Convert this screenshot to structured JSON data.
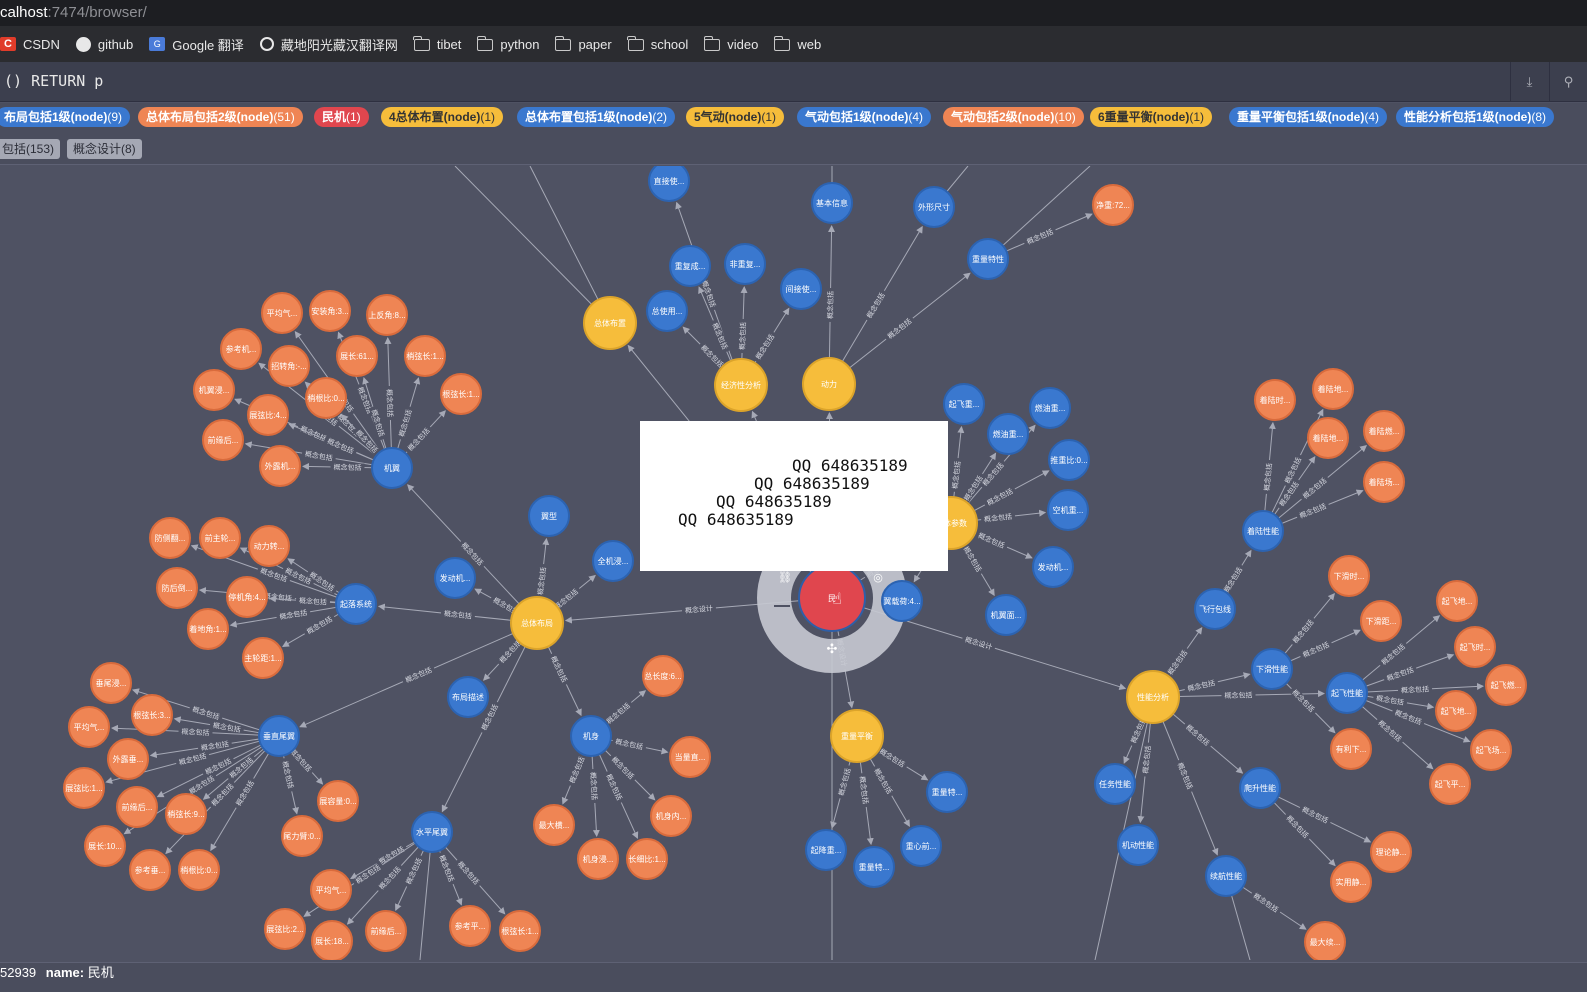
{
  "browser": {
    "url_host": "calhost",
    "url_rest": ":7474/browser/",
    "bookmarks": [
      {
        "label": "CSDN",
        "icon": "csdn-icon"
      },
      {
        "label": "github",
        "icon": "github-icon"
      },
      {
        "label": "Google 翻译",
        "icon": "google-translate-icon"
      },
      {
        "label": "藏地阳光藏汉翻译网",
        "icon": "globe-icon"
      },
      {
        "label": "tibet",
        "icon": "folder-icon"
      },
      {
        "label": "python",
        "icon": "folder-icon"
      },
      {
        "label": "paper",
        "icon": "folder-icon"
      },
      {
        "label": "school",
        "icon": "folder-icon"
      },
      {
        "label": "video",
        "icon": "folder-icon"
      },
      {
        "label": "web",
        "icon": "folder-icon"
      }
    ]
  },
  "editor": {
    "query": "() RETURN p",
    "download_icon": "download-icon",
    "pin_icon": "pin-icon"
  },
  "labels": [
    {
      "name": "布局包括1级(node)",
      "count": "(9)",
      "color": "blue"
    },
    {
      "name": "总体布局包括2级(node)",
      "count": "(51)",
      "color": "orange"
    },
    {
      "name": "民机",
      "count": "(1)",
      "color": "red"
    },
    {
      "name": "4总体布置(node)",
      "count": "(1)",
      "color": "yellow"
    },
    {
      "name": "总体布置包括1级(node)",
      "count": "(2)",
      "color": "blue"
    },
    {
      "name": "5气动(node)",
      "count": "(1)",
      "color": "yellow"
    },
    {
      "name": "气动包括1级(node)",
      "count": "(4)",
      "color": "blue"
    },
    {
      "name": "气动包括2级(node)",
      "count": "(10)",
      "color": "orange"
    },
    {
      "name": "6重量平衡(node)",
      "count": "(1)",
      "color": "yellow"
    },
    {
      "name": "重量平衡包括1级(node)",
      "count": "(4)",
      "color": "blue"
    },
    {
      "name": "性能分析包括1级(node)",
      "count": "(8)",
      "color": "blue"
    }
  ],
  "relationships": [
    {
      "name": "包括",
      "count": "(153)"
    },
    {
      "name": "概念设计",
      "count": "(8)"
    }
  ],
  "watermark": {
    "lines": [
      "QQ 648635189",
      "QQ 648635189",
      "QQ 648635189",
      "QQ 648635189"
    ]
  },
  "status": {
    "id_fragment": "52939",
    "key": "name:",
    "value": "民机"
  },
  "colors": {
    "blue": "#3a78cf",
    "orange": "#ef8554",
    "yellow": "#f6bd3b",
    "red": "#e0464e",
    "background": "#4f5263"
  },
  "graph": {
    "edge_labels": {
      "include": "概念包括",
      "design": "概念设计"
    },
    "hubs": [
      {
        "id": "zongtibuju",
        "label": "总体布局",
        "color": "yellow"
      },
      {
        "id": "zongtibuzhi",
        "label": "总体布置",
        "color": "yellow"
      },
      {
        "id": "jingji",
        "label": "经济性分析",
        "color": "yellow"
      },
      {
        "id": "dongli",
        "label": "动力",
        "color": "yellow"
      },
      {
        "id": "zongticanshu",
        "label": "总体参数",
        "color": "yellow"
      },
      {
        "id": "zhongliang",
        "label": "重量平衡",
        "color": "yellow"
      },
      {
        "id": "xingneng",
        "label": "性能分析",
        "color": "yellow"
      }
    ],
    "center": {
      "label": "民",
      "color": "red"
    },
    "nodes": [
      {
        "id": "jiyi",
        "label": "机翼",
        "color": "blue"
      },
      {
        "id": "qiluo",
        "label": "起落系统",
        "color": "blue"
      },
      {
        "id": "chuizhi",
        "label": "垂直尾翼",
        "color": "blue"
      },
      {
        "id": "shuiping",
        "label": "水平尾翼",
        "color": "blue"
      },
      {
        "id": "jishen",
        "label": "机身",
        "color": "blue"
      },
      {
        "id": "buju",
        "label": "布局描述",
        "color": "blue"
      },
      {
        "id": "fadong",
        "label": "发动机...",
        "color": "blue"
      },
      {
        "id": "yixing",
        "label": "翼型",
        "color": "blue"
      },
      {
        "id": "quanji",
        "label": "全机浸...",
        "color": "blue"
      },
      {
        "id": "zhijie",
        "label": "直接使...",
        "color": "blue"
      },
      {
        "id": "chongfu",
        "label": "重复成...",
        "color": "blue"
      },
      {
        "id": "feichong",
        "label": "非重复...",
        "color": "blue"
      },
      {
        "id": "zongshiyong",
        "label": "总使用...",
        "color": "blue"
      },
      {
        "id": "jianjie",
        "label": "间接使...",
        "color": "blue"
      },
      {
        "id": "jiben",
        "label": "基本信息",
        "color": "blue"
      },
      {
        "id": "waixing",
        "label": "外形尺寸",
        "color": "blue"
      },
      {
        "id": "zhongliangtx",
        "label": "重量特性",
        "color": "blue"
      },
      {
        "id": "qifeizhong",
        "label": "起飞重...",
        "color": "blue"
      },
      {
        "id": "ranyou1",
        "label": "燃油重...",
        "color": "blue"
      },
      {
        "id": "ranyou2",
        "label": "燃油重...",
        "color": "blue"
      },
      {
        "id": "tuizhong",
        "label": "推重比:0...",
        "color": "blue"
      },
      {
        "id": "kongji",
        "label": "空机重...",
        "color": "blue"
      },
      {
        "id": "fadongji2",
        "label": "发动机...",
        "color": "blue"
      },
      {
        "id": "jiyimian",
        "label": "机翼面...",
        "color": "blue"
      },
      {
        "id": "yizaihe",
        "label": "翼载荷:4...",
        "color": "blue"
      },
      {
        "id": "zhongliangte2",
        "label": "重量特...",
        "color": "blue"
      },
      {
        "id": "zhongxin",
        "label": "重心前...",
        "color": "blue"
      },
      {
        "id": "zhongliangte3",
        "label": "重量特...",
        "color": "blue"
      },
      {
        "id": "qijiang",
        "label": "起降重...",
        "color": "blue"
      },
      {
        "id": "feixing",
        "label": "飞行包线",
        "color": "blue"
      },
      {
        "id": "zhuolu",
        "label": "着陆性能",
        "color": "blue"
      },
      {
        "id": "xiahua",
        "label": "下滑性能",
        "color": "blue"
      },
      {
        "id": "qifei",
        "label": "起飞性能",
        "color": "blue"
      },
      {
        "id": "renwu",
        "label": "任务性能",
        "color": "blue"
      },
      {
        "id": "pasheng",
        "label": "爬升性能",
        "color": "blue"
      },
      {
        "id": "jidong",
        "label": "机动性能",
        "color": "blue"
      },
      {
        "id": "xuhang",
        "label": "续航性能",
        "color": "blue"
      }
    ],
    "leaves": [
      "平均气...",
      "安装角:3...",
      "上反角:8...",
      "参考机...",
      "招转角:-...",
      "展长:61...",
      "梢弦长:1...",
      "机翼浸...",
      "梢根比:0...",
      "展弦比:4...",
      "根弦长:1...",
      "前缘后...",
      "外露机...",
      "防侧翻...",
      "前主轮...",
      "动力转...",
      "防后倒...",
      "停机角:4...",
      "着地角:1...",
      "主轮距:1...",
      "垂尾浸...",
      "根弦长:3...",
      "平均气...",
      "外露垂...",
      "展弦比:1...",
      "前缘后...",
      "梢弦长:9...",
      "展长:10...",
      "参考垂...",
      "梢根比:0...",
      "展容量:0...",
      "尾力臂:0...",
      "平均气...",
      "展弦比:2...",
      "展长:18...",
      "前缘后...",
      "参考平...",
      "根弦长:1...",
      "总长度:6...",
      "当量直...",
      "机身内...",
      "最大横...",
      "机身浸...",
      "长细比:1...",
      "净重:72...",
      "着陆时...",
      "着陆地...",
      "着陆地...",
      "着陆燃...",
      "着陆场...",
      "下滑时...",
      "下滑距...",
      "有利下...",
      "起飞地...",
      "起飞时...",
      "起飞燃...",
      "起飞地...",
      "起飞场...",
      "起飞平...",
      "理论静...",
      "实用静...",
      "最大续..."
    ]
  }
}
